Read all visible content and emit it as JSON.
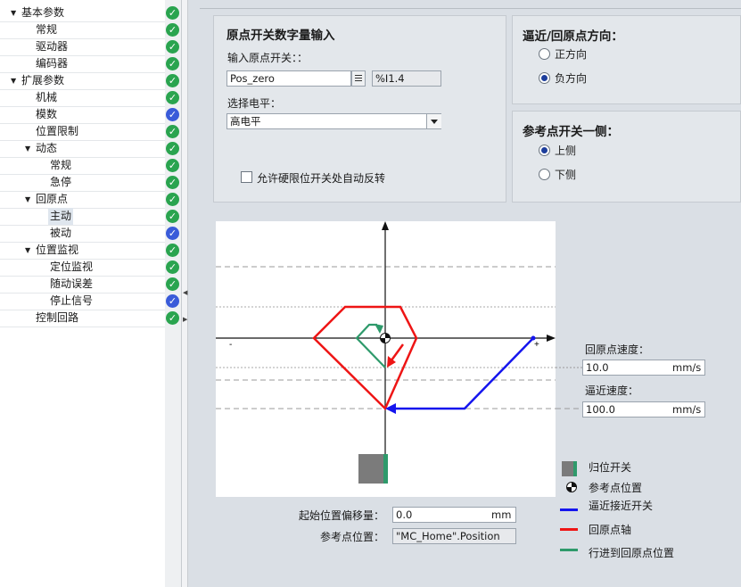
{
  "tree": {
    "items": [
      {
        "label": "基本参数",
        "expanded": true,
        "status": "ok"
      },
      {
        "label": "常规",
        "status": "ok"
      },
      {
        "label": "驱动器",
        "status": "ok"
      },
      {
        "label": "编码器",
        "status": "ok"
      },
      {
        "label": "扩展参数",
        "expanded": true,
        "status": "ok"
      },
      {
        "label": "机械",
        "status": "ok"
      },
      {
        "label": "模数",
        "status": "warning"
      },
      {
        "label": "位置限制",
        "status": "ok"
      },
      {
        "label": "动态",
        "expanded": true,
        "status": "ok"
      },
      {
        "label": "常规",
        "status": "ok"
      },
      {
        "label": "急停",
        "status": "ok"
      },
      {
        "label": "回原点",
        "expanded": true,
        "status": "ok"
      },
      {
        "label": "主动",
        "selected": true,
        "status": "ok"
      },
      {
        "label": "被动",
        "status": "warning"
      },
      {
        "label": "位置监视",
        "expanded": true,
        "status": "ok"
      },
      {
        "label": "定位监视",
        "status": "ok"
      },
      {
        "label": "随动误差",
        "status": "ok"
      },
      {
        "label": "停止信号",
        "status": "warning"
      },
      {
        "label": "控制回路",
        "status": "ok"
      }
    ]
  },
  "home_switch": {
    "title": "原点开关数字量输入",
    "input_label": "输入原点开关：：",
    "input_value": "Pos_zero",
    "address": "%I1.4",
    "level_label": "选择电平：",
    "level_value": "高电平",
    "auto_reverse_label": "允许硬限位开关处自动反转",
    "auto_reverse_checked": false
  },
  "direction": {
    "title": "逼近/回原点方向：",
    "options": [
      "正方向",
      "负方向"
    ],
    "selected": "负方向"
  },
  "ref_side": {
    "title": "参考点开关一侧：",
    "options": [
      "上侧",
      "下侧"
    ],
    "selected": "上侧"
  },
  "diagram": {
    "axis_minus": "-",
    "axis_plus": "+"
  },
  "speeds": {
    "homing_label": "回原点速度：",
    "homing_value": "10.0",
    "homing_unit": "mm/s",
    "approach_label": "逼近速度：",
    "approach_value": "100.0",
    "approach_unit": "mm/s"
  },
  "offset": {
    "label": "起始位置偏移量：",
    "value": "0.0",
    "unit": "mm",
    "ref_label": "参考点位置：",
    "ref_value": "\"MC_Home\".Position"
  },
  "legend": {
    "items": [
      {
        "label": "归位开关",
        "icon": "switch-block-icon"
      },
      {
        "label": "参考点位置",
        "icon": "reference-point-icon"
      },
      {
        "label": "逼近接近开关",
        "color": "#1515ee"
      },
      {
        "label": "回原点轴",
        "color": "#ee1515"
      },
      {
        "label": "行进到回原点位置",
        "color": "#2e9a6b"
      }
    ]
  },
  "colors": {
    "approach": "#1515ee",
    "homing": "#ee1515",
    "travel": "#2e9a6b",
    "status_ok": "#2aa44f",
    "status_warning": "#3a5bd9"
  }
}
